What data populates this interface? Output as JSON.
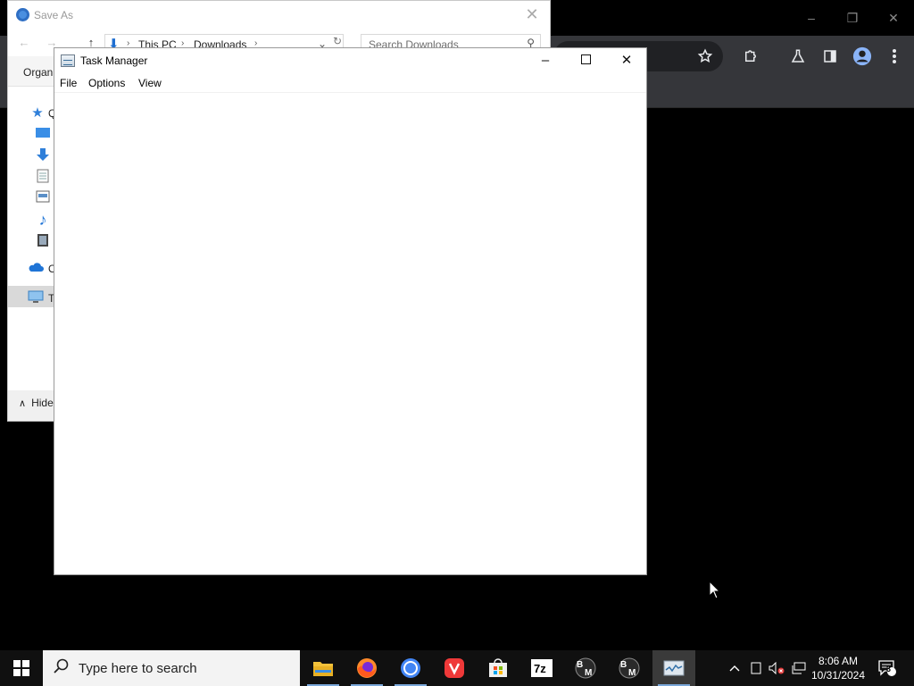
{
  "chrome": {
    "window_controls": {
      "minimize": "–",
      "restore": "❐",
      "close": "✕"
    }
  },
  "save_as": {
    "title": "Save As",
    "close": "✕",
    "nav": {
      "back": "←",
      "forward": "→",
      "up": "↑"
    },
    "breadcrumb": [
      "This PC",
      "Downloads"
    ],
    "search_placeholder": "Search Downloads",
    "organize_label": "Organ",
    "nav_items": [
      {
        "icon": "quick-access-star-icon",
        "label": "Q"
      },
      {
        "icon": "desktop-icon",
        "label": ""
      },
      {
        "icon": "downloads-arrow-icon",
        "label": ""
      },
      {
        "icon": "documents-icon",
        "label": ""
      },
      {
        "icon": "pictures-icon",
        "label": ""
      },
      {
        "icon": "music-note-icon",
        "label": ""
      },
      {
        "icon": "videos-icon",
        "label": ""
      },
      {
        "icon": "onedrive-cloud-icon",
        "label": "O"
      },
      {
        "icon": "this-pc-monitor-icon",
        "label": "T"
      }
    ],
    "hide_folders": "Hide"
  },
  "task_manager": {
    "title": "Task Manager",
    "menu": [
      "File",
      "Options",
      "View"
    ],
    "controls": {
      "minimize": "–",
      "maximize": "☐",
      "close": "✕"
    }
  },
  "taskbar": {
    "search_placeholder": "Type here to search",
    "apps": [
      {
        "name": "file-explorer",
        "running": true
      },
      {
        "name": "firefox",
        "running": true
      },
      {
        "name": "chrome",
        "running": true
      },
      {
        "name": "vivaldi",
        "running": false
      },
      {
        "name": "microsoft-store",
        "running": false
      },
      {
        "name": "7zip",
        "running": false
      },
      {
        "name": "bm-app-1",
        "running": false
      },
      {
        "name": "bm-app-2",
        "running": false
      },
      {
        "name": "task-manager",
        "running": true,
        "active": true
      }
    ],
    "time": "8:06 AM",
    "date": "10/31/2024",
    "notification_count": "3"
  }
}
